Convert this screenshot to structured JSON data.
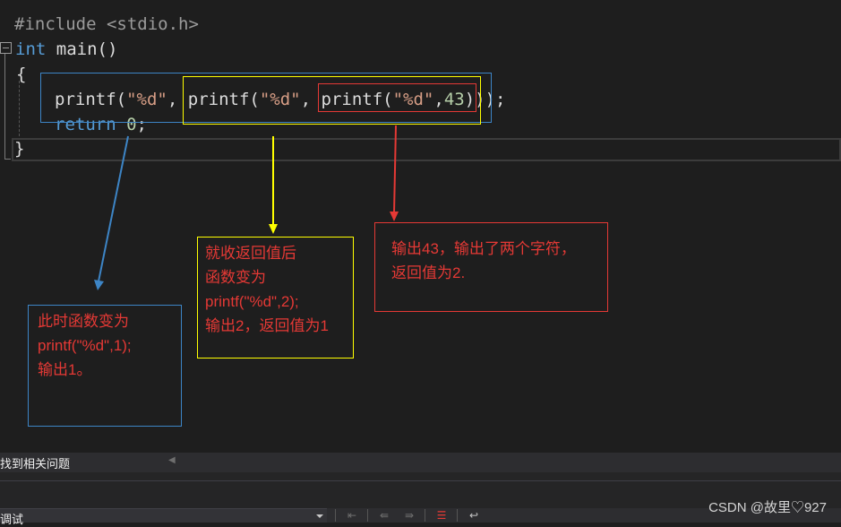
{
  "code": {
    "line1": {
      "directive": "#include",
      "header": "<stdio.h>"
    },
    "line2": {
      "type_kw": "int",
      "name": "main",
      "parens": "()"
    },
    "line3": {
      "brace": "{"
    },
    "line4": {
      "call1": "printf",
      "p1": "(",
      "fmt1": "\"%d\"",
      "c1": ", ",
      "call2": "printf",
      "p2": "(",
      "fmt2": "\"%d\"",
      "c2": ", ",
      "call3": "printf",
      "p3": "(",
      "fmt3": "\"%d\"",
      "c3": ",",
      "num": "43",
      "close": "));",
      "closeinner": ")"
    },
    "line5": {
      "ret_kw": "return",
      "ret_val": "0",
      "semi": ";"
    },
    "line6": {
      "brace": "}"
    }
  },
  "notes": {
    "blue": [
      "此时函数变为",
      "printf(\"%d\",1);",
      "输出1。"
    ],
    "yellow": [
      "就收返回值后",
      "函数变为",
      "printf(\"%d\",2);",
      "输出2，返回值为1"
    ],
    "red": [
      "输出43，输出了两个字符，",
      "返回值为2."
    ]
  },
  "colors": {
    "blue": "#3d85c6",
    "yellow": "#ffff00",
    "red": "#e53935"
  },
  "panel": {
    "title": "找到相关问题",
    "dropdown_label": "调试"
  },
  "toolbar_icons": [
    "step-back-icon",
    "prev-icon",
    "next-icon",
    "clear-icon",
    "word-wrap-icon"
  ],
  "watermark": "CSDN @故里♡927"
}
